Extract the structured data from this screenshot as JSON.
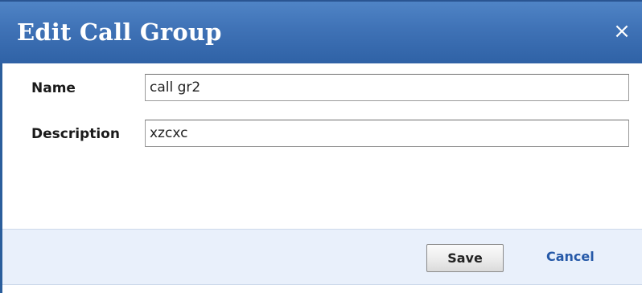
{
  "dialog": {
    "title": "Edit Call Group",
    "close_glyph": "×",
    "close_icon": "close-icon"
  },
  "form": {
    "name_label": "Name",
    "name_value": "call gr2",
    "description_label": "Description",
    "description_value": "xzcxc"
  },
  "footer": {
    "save_label": "Save",
    "cancel_label": "Cancel"
  },
  "colors": {
    "titlebar": "#3f72b6",
    "footer_bg": "#e9f0fb",
    "link": "#2659a8"
  }
}
